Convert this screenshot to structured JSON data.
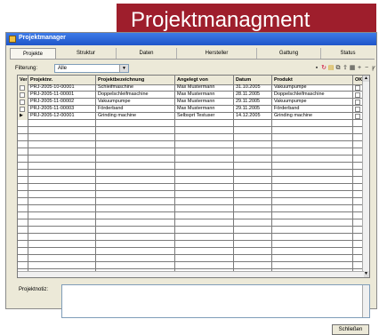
{
  "banner": {
    "title": "Projektmanagment"
  },
  "window": {
    "title": "Projektmanager"
  },
  "tabs": [
    "Projekte",
    "Struktur",
    "Daten",
    "Hersteller",
    "Gattung",
    "Status"
  ],
  "filter": {
    "label": "Filterung:",
    "value": "Alle"
  },
  "toolbar_icons": [
    "printer-icon",
    "refresh-icon",
    "open-icon",
    "copy-icon",
    "export-icon",
    "report-icon",
    "add-icon",
    "remove-icon",
    "filter-icon"
  ],
  "grid": {
    "columns": [
      "Ver",
      "Projektnr.",
      "Projektbezeichnung",
      "Angelegt von",
      "Datum",
      "Produkt",
      "OK"
    ],
    "rows": [
      [
        "",
        "PRJ-2005-10-00001",
        "Schleifmaschine",
        "Max Mustermann",
        "31.10.2005",
        "Vakuumpumpe",
        ""
      ],
      [
        "",
        "PRJ-2005-11-00001",
        "Doppelschleifmaschine",
        "Max Mustermann",
        "28.11.2005",
        "Doppelschleifmaschine",
        ""
      ],
      [
        "",
        "PRJ-2005-11-00002",
        "Vakuumpumpe",
        "Max Mustermann",
        "29.11.2005",
        "Vakuumpumpe",
        ""
      ],
      [
        "",
        "PRJ-2005-11-00003",
        "Förderband",
        "Max Mustermann",
        "29.11.2005",
        "Förderband",
        ""
      ],
      [
        "▶",
        "PRJ-2005-12-00001",
        "Grinding machine",
        "Selbsprt Testuser",
        "14.12.2005",
        "Grinding machine",
        ""
      ]
    ]
  },
  "notes": {
    "label": "Projektnotiz:"
  },
  "close_button": "Schließen"
}
